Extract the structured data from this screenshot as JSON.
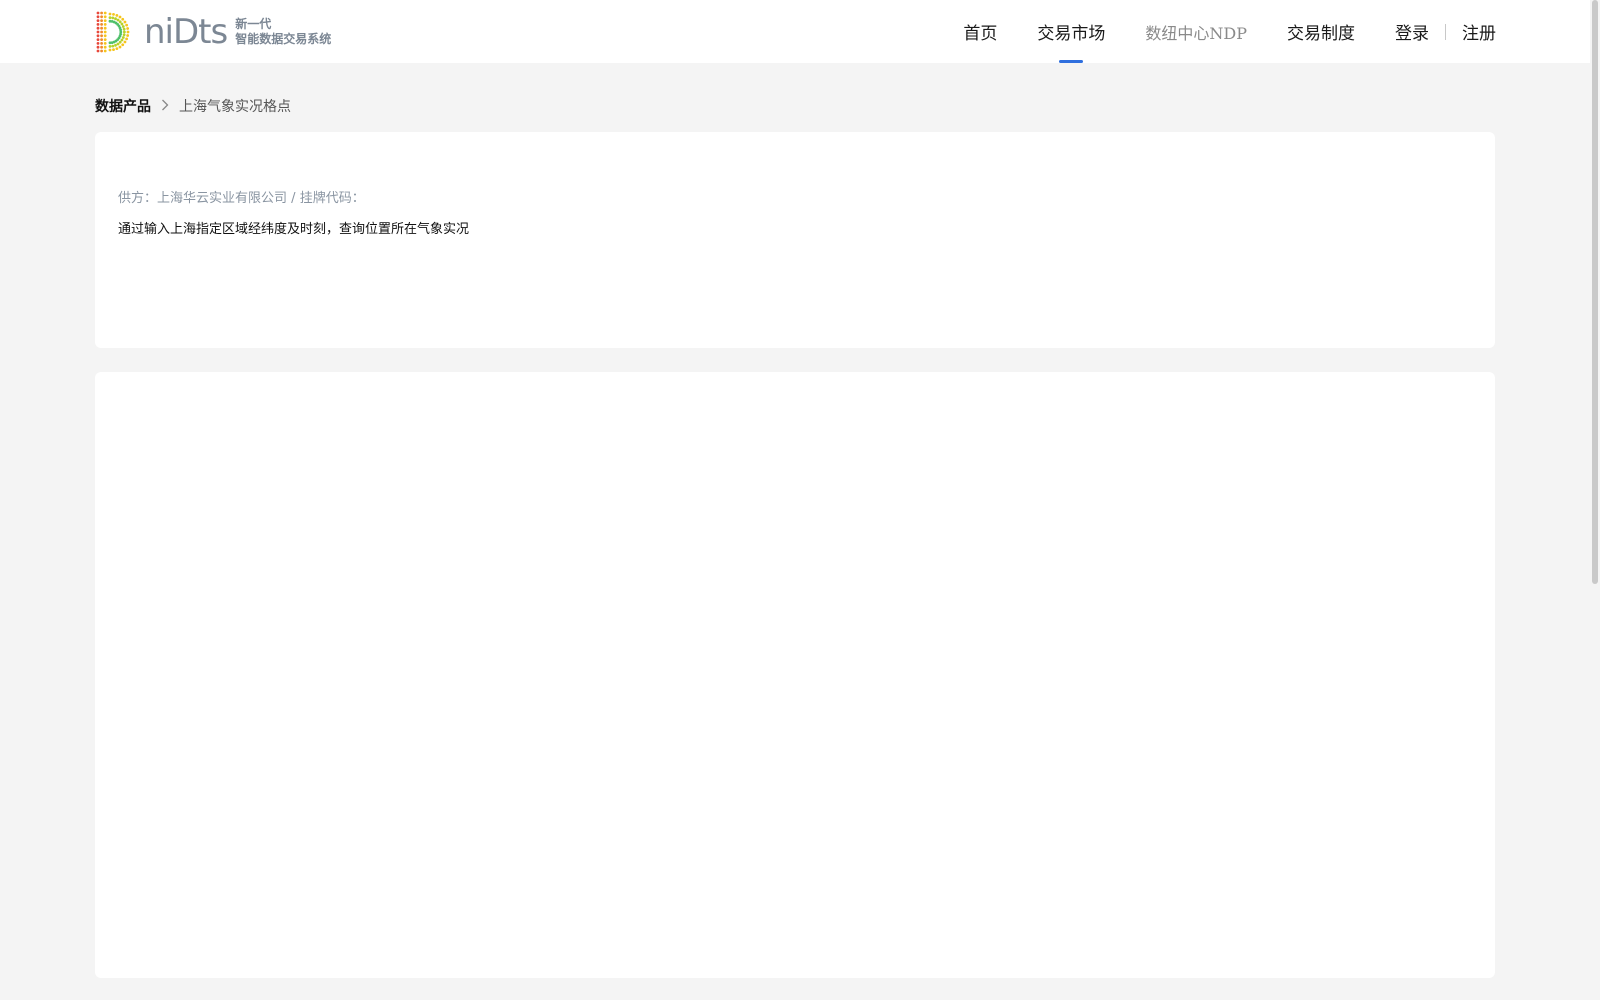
{
  "header": {
    "logo_word": "niDts",
    "logo_slogan_line1": "新一代",
    "logo_slogan_line2": "智能数据交易系统",
    "nav": [
      {
        "label": "首页"
      },
      {
        "label": "交易市场"
      },
      {
        "label": "数纽中心NDP"
      },
      {
        "label": "交易制度"
      }
    ],
    "login_label": "登录",
    "register_label": "注册",
    "accent_color": "#2f6fde"
  },
  "breadcrumb": {
    "root": "数据产品",
    "current": "上海气象实况格点"
  },
  "product": {
    "supplier_label": "供方：",
    "supplier": "上海华云实业有限公司",
    "separator": " / ",
    "listing_code_label": "挂牌代码：",
    "listing_code": "",
    "description": "通过输入上海指定区域经纬度及时刻，查询位置所在气象实况"
  },
  "icons": [
    "logo-d-icon",
    "chevron-right-icon"
  ]
}
